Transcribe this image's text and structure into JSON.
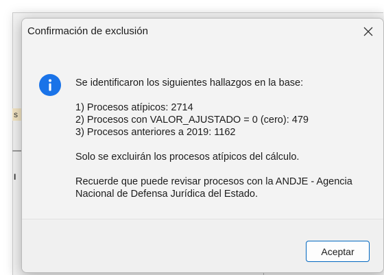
{
  "dialog": {
    "title": "Confirmación de exclusión",
    "close_label": "✕",
    "icon": "info-icon",
    "lines": {
      "intro": "Se identificaron los siguientes hallazgos en la base:",
      "item1": "1) Procesos atípicos: 2714",
      "item2": "2) Procesos con VALOR_AJUSTADO = 0 (cero): 479",
      "item3": "3) Procesos anteriores a 2019: 1162",
      "note": "Solo se excluirán los procesos atípicos del cálculo.",
      "reminder1": "Recuerde que puede revisar procesos con la ANDJE - Agencia",
      "reminder2": "Nacional de Defensa Jurídica del Estado."
    },
    "ok_label": "Aceptar"
  },
  "background": {
    "fragment1": "s",
    "fragment2": "I"
  },
  "colors": {
    "accent": "#0067c0",
    "info_icon": "#1a73e8",
    "dialog_bg": "#f3f3f3"
  }
}
